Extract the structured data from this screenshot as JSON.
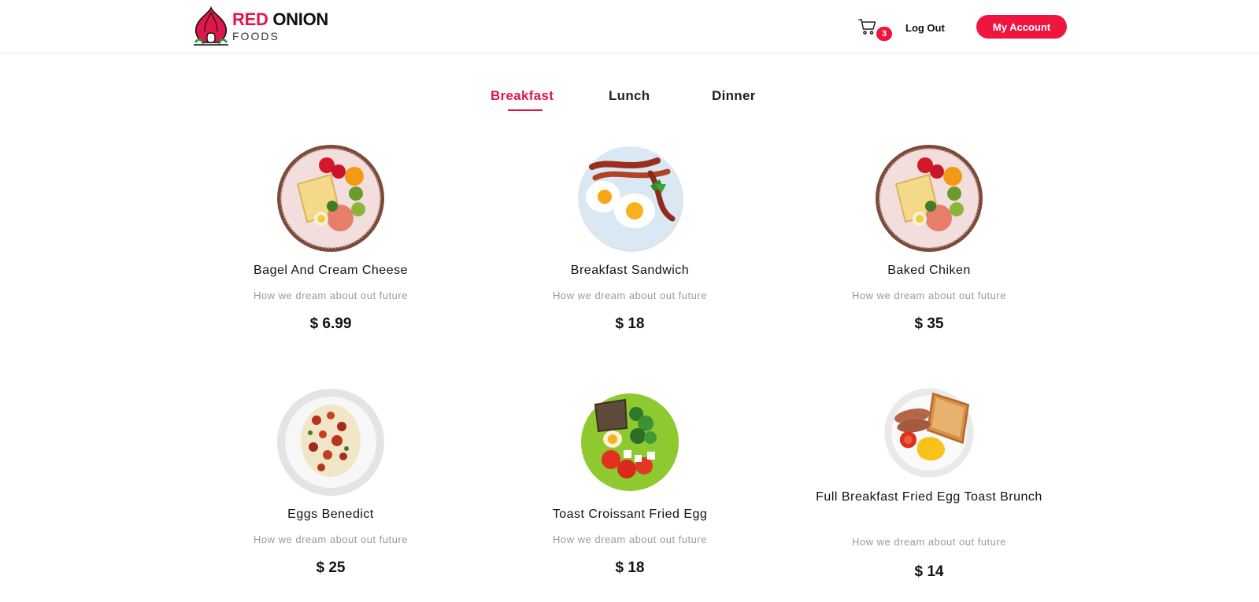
{
  "brand": {
    "name_red": "RED",
    "name_dark": "ONION",
    "tagline": "FOODS",
    "accent_color": "#e0174a"
  },
  "header": {
    "cart_icon": "cart-icon",
    "cart_count": "3",
    "logout_label": "Log Out",
    "account_label": "My Account"
  },
  "tabs": [
    {
      "label": "Breakfast",
      "active": true
    },
    {
      "label": "Lunch",
      "active": false
    },
    {
      "label": "Dinner",
      "active": false
    }
  ],
  "items": [
    {
      "title": "Bagel And Cream Cheese",
      "subtitle": "How we dream about out future",
      "price": "$ 6.99",
      "image": "fruit-toast-plate"
    },
    {
      "title": "Breakfast Sandwich",
      "subtitle": "How we dream about out future",
      "price": "$ 18",
      "image": "bacon-eggs-plate"
    },
    {
      "title": "Baked Chiken",
      "subtitle": "How we dream about out future",
      "price": "$ 35",
      "image": "fruit-toast-plate"
    },
    {
      "title": "Eggs Benedict",
      "subtitle": "How we dream about out future",
      "price": "$ 25",
      "image": "eggs-benedict-plate"
    },
    {
      "title": "Toast Croissant Fried Egg",
      "subtitle": "How we dream about out future",
      "price": "$ 18",
      "image": "salad-toast-plate"
    },
    {
      "title": "Full Breakfast Fried Egg Toast Brunch",
      "subtitle": "How we dream about out future",
      "price": "$ 14",
      "image": "toast-sausage-plate"
    }
  ]
}
